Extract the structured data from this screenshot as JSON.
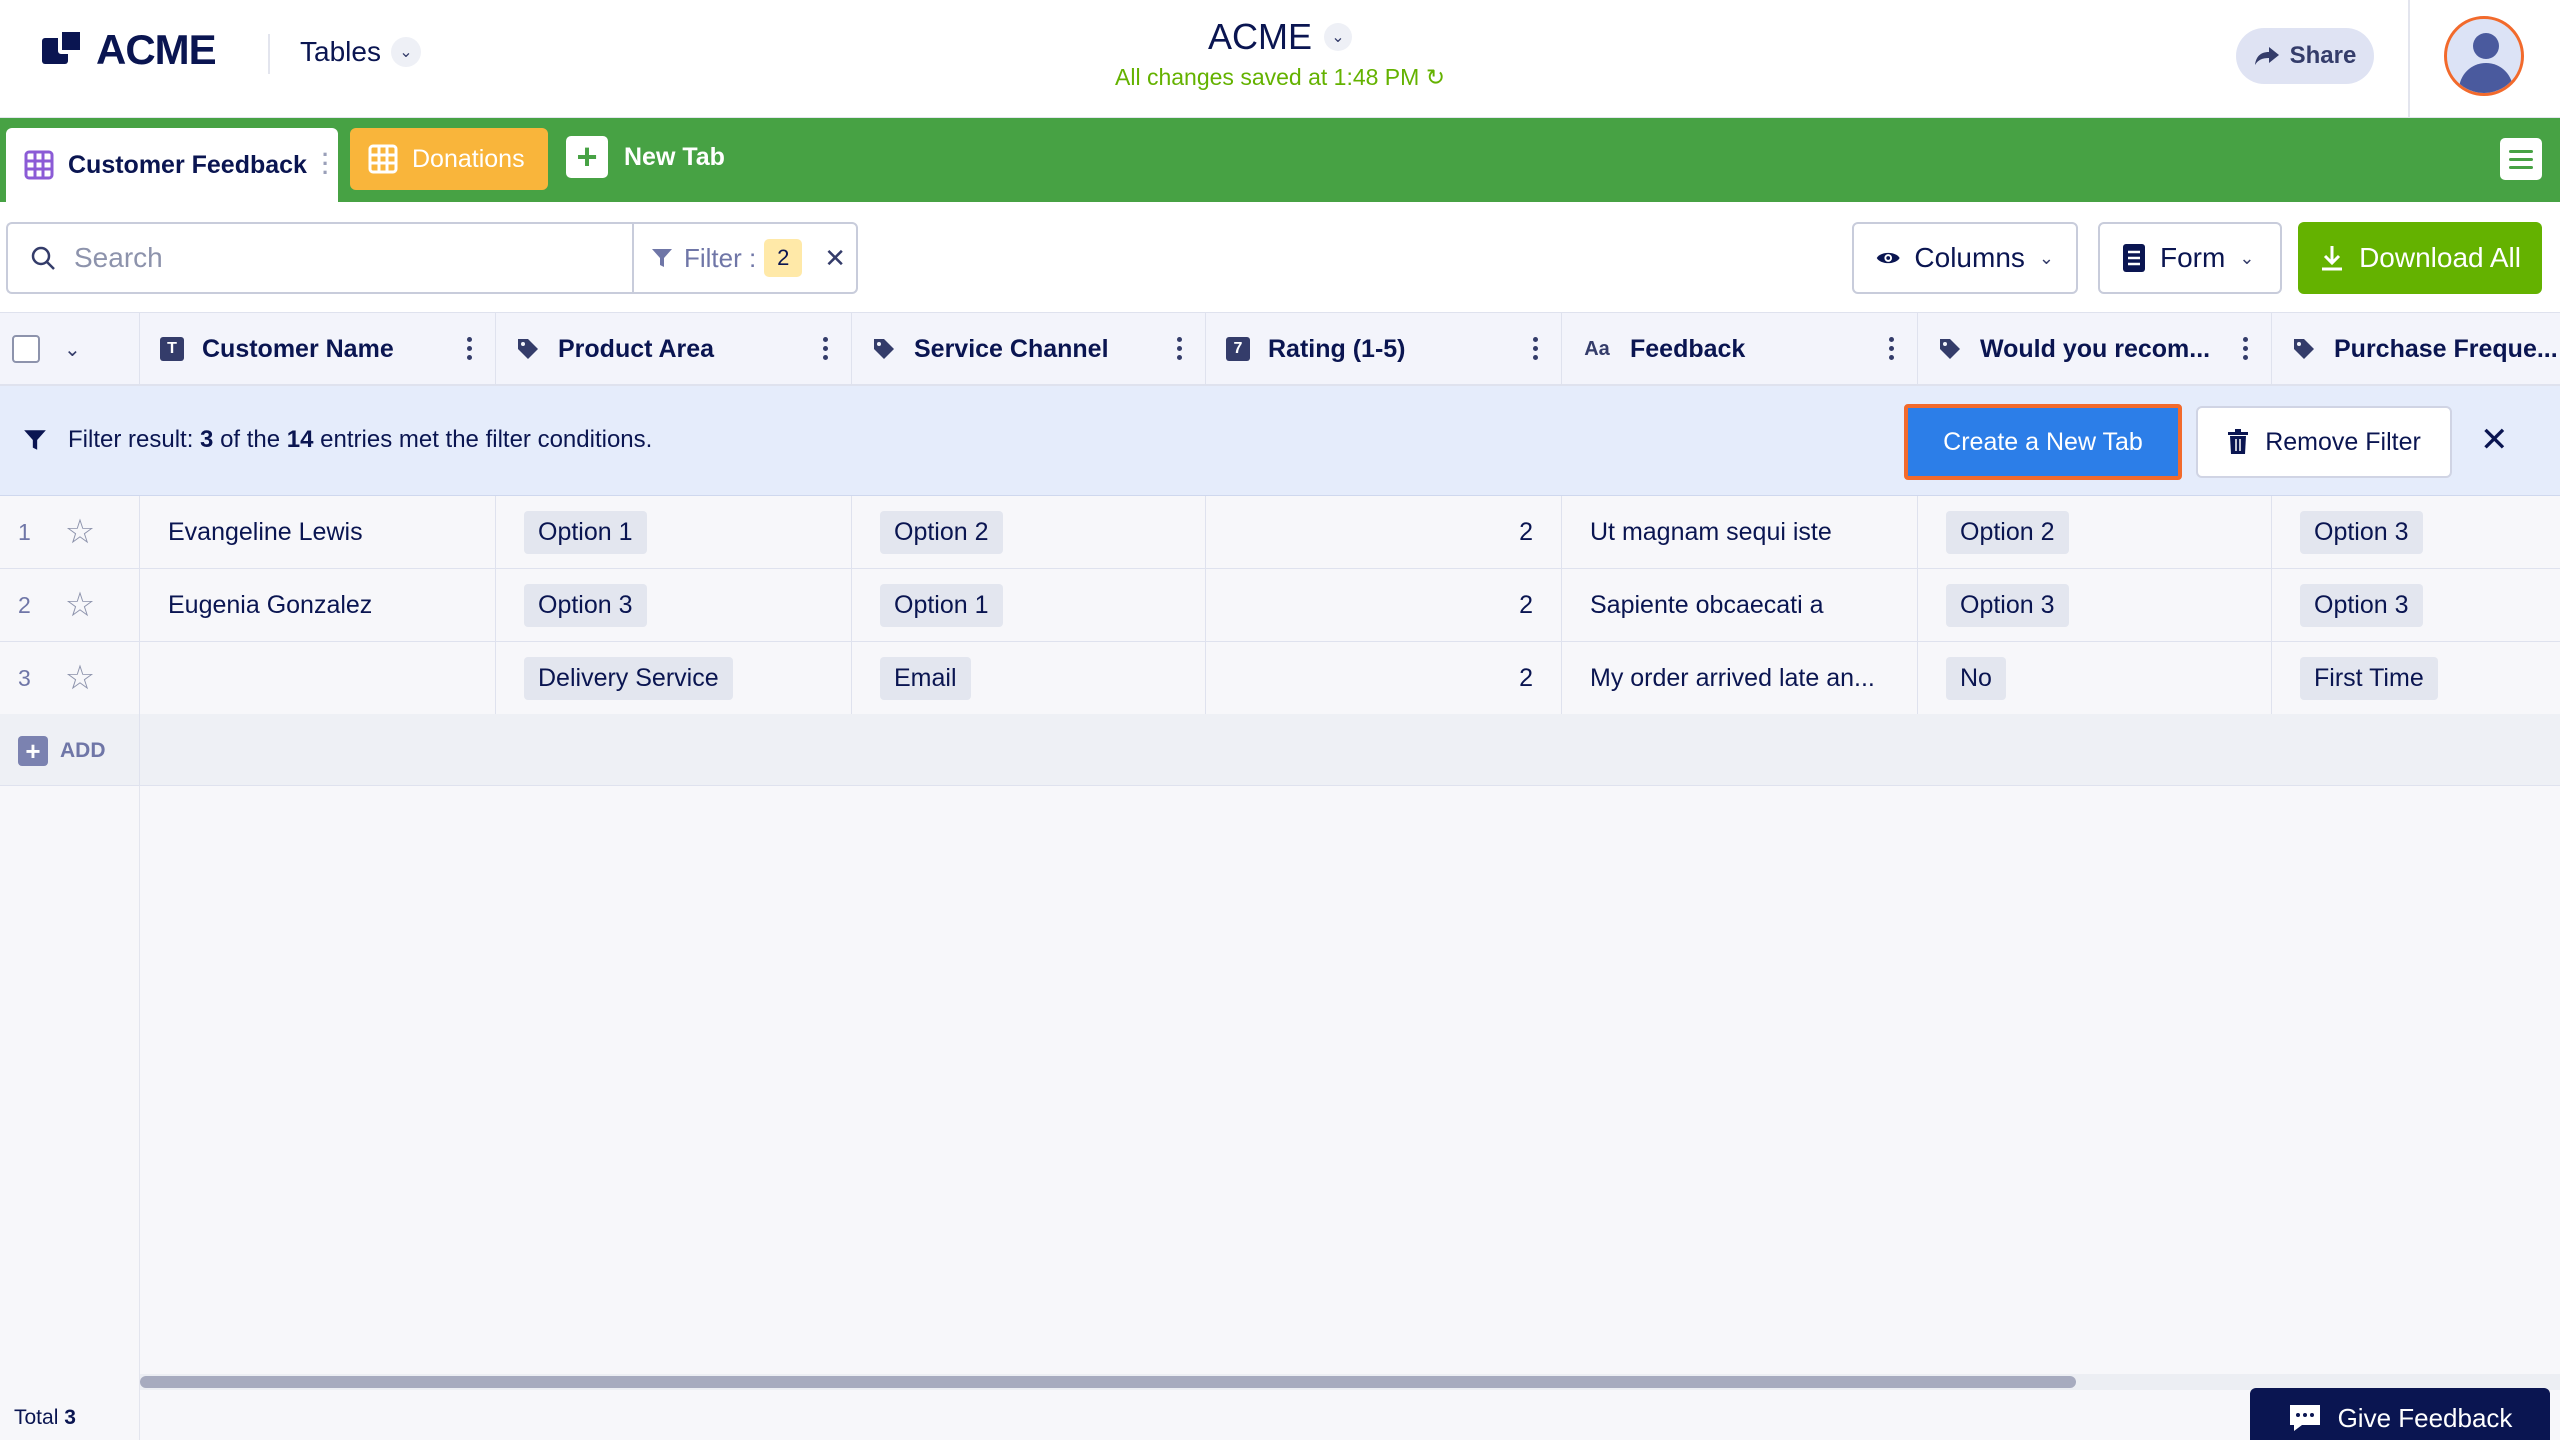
{
  "header": {
    "logo_text": "ACME",
    "section_label": "Tables",
    "app_title": "ACME",
    "saved_status": "All changes saved at 1:48 PM",
    "share_label": "Share"
  },
  "tabs": {
    "active_label": "Customer Feedback",
    "second_label": "Donations",
    "new_tab_label": "New Tab"
  },
  "toolbar": {
    "search_placeholder": "Search",
    "filter_label": "Filter :",
    "filter_count": "2",
    "columns_label": "Columns",
    "form_label": "Form",
    "download_label": "Download All"
  },
  "columns": [
    {
      "label": "Customer Name",
      "icon": "text-field-icon"
    },
    {
      "label": "Product Area",
      "icon": "tag-icon"
    },
    {
      "label": "Service Channel",
      "icon": "tag-icon"
    },
    {
      "label": "Rating (1-5)",
      "icon": "number-field-icon"
    },
    {
      "label": "Feedback",
      "icon": "long-text-icon"
    },
    {
      "label": "Would you recom...",
      "icon": "tag-icon"
    },
    {
      "label": "Purchase Freque...",
      "icon": "tag-icon"
    }
  ],
  "filter_banner": {
    "prefix": "Filter result:",
    "matched": "3",
    "of_the": "of the",
    "total": "14",
    "suffix": "entries met the filter conditions.",
    "create_tab_label": "Create a New Tab",
    "remove_filter_label": "Remove Filter"
  },
  "rows": [
    {
      "index": "1",
      "customer_name": "Evangeline Lewis",
      "product_area": "Option 1",
      "service_channel": "Option 2",
      "rating": "2",
      "feedback": "Ut magnam sequi iste",
      "recommend": "Option 2",
      "purchase_frequency": "Option 3"
    },
    {
      "index": "2",
      "customer_name": "Eugenia Gonzalez",
      "product_area": "Option 3",
      "service_channel": "Option 1",
      "rating": "2",
      "feedback": "Sapiente obcaecati a",
      "recommend": "Option 3",
      "purchase_frequency": "Option 3"
    },
    {
      "index": "3",
      "customer_name": "",
      "product_area": "Delivery Service",
      "service_channel": "Email",
      "rating": "2",
      "feedback": "My order arrived late an...",
      "recommend": "No",
      "purchase_frequency": "First Time"
    }
  ],
  "add_label": "ADD",
  "footer": {
    "total_label": "Total",
    "total_count": "3",
    "give_feedback_label": "Give Feedback"
  },
  "colors": {
    "tab_bar": "#47a244",
    "donations_tab": "#f9b53b",
    "download_button": "#64b200",
    "create_tab_button": "#2c7ee8",
    "highlight_outline": "#f26a2c",
    "navy": "#0a1551"
  }
}
